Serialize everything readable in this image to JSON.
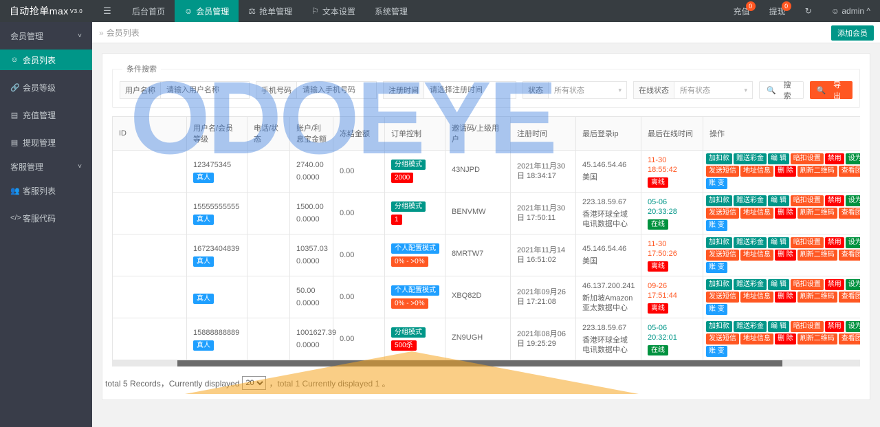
{
  "topbar": {
    "brand": "自动抢单max",
    "brand_version": "V3.0",
    "hamburger_icon": "menu-icon",
    "nav": [
      {
        "label": "后台首页",
        "icon": "",
        "active": false
      },
      {
        "label": "会员管理",
        "icon": "user-icon",
        "active": true
      },
      {
        "label": "抢单管理",
        "icon": "scale-icon",
        "active": false
      },
      {
        "label": "文本设置",
        "icon": "flag-icon",
        "active": false
      },
      {
        "label": "系统管理",
        "icon": "",
        "active": false
      }
    ],
    "recharge_label": "充值",
    "recharge_badge": "0",
    "withdraw_label": "提现",
    "withdraw_badge": "0",
    "refresh_icon": "refresh-icon",
    "user_label": "admin",
    "user_icon": "user-icon",
    "user_chevron": "chevron-up-icon"
  },
  "sidebar": {
    "groups": [
      {
        "label": "会员管理",
        "items": [
          {
            "label": "会员列表",
            "icon": "user-icon",
            "active": true
          },
          {
            "label": "会员等级",
            "icon": "link-icon",
            "active": false
          },
          {
            "label": "充值管理",
            "icon": "monitor-icon",
            "active": false
          },
          {
            "label": "提现管理",
            "icon": "monitor-icon",
            "active": false
          }
        ]
      },
      {
        "label": "客服管理",
        "items": [
          {
            "label": "客服列表",
            "icon": "users-icon",
            "active": false
          },
          {
            "label": "客服代码",
            "icon": "code-icon",
            "active": false
          }
        ]
      }
    ]
  },
  "breadcrumb": {
    "arrow": "»",
    "current": "会员列表",
    "add_button": "添加会员"
  },
  "search": {
    "legend": "条件搜索",
    "username": {
      "label": "用户名称",
      "placeholder": "请输入用户名称",
      "value": ""
    },
    "phone": {
      "label": "手机号码",
      "placeholder": "请输入手机号码",
      "value": ""
    },
    "regtime": {
      "label": "注册时间",
      "placeholder": "请选择注册时间",
      "value": ""
    },
    "status": {
      "label": "状态",
      "value": "所有状态"
    },
    "online": {
      "label": "在线状态",
      "value": "所有状态"
    },
    "search_button": "搜 索",
    "export_button": "导 出",
    "search_icon": "search-icon",
    "export_icon": "search-icon"
  },
  "table": {
    "columns": [
      "ID",
      "用户名/会员等级",
      "电话/状态",
      "账户/利息宝金额",
      "冻结金额",
      "订单控制",
      "邀请码/上级用户",
      "注册时间",
      "最后登录ip",
      "最后在线时间",
      "操作"
    ],
    "rows": [
      {
        "id": "",
        "username": "123475345",
        "level_tag": "真人",
        "phone": "",
        "status_tag": "",
        "account": "2740.00",
        "interest": "0.0000",
        "frozen": "0.00",
        "order_mode": "分组模式",
        "order_mode_color": "teal",
        "order_value": "2000",
        "order_value_color": "red",
        "invite_code": "43NJPD",
        "parent_user": "",
        "reg_time": "2021年11月30日 18:34:17",
        "last_ip": "45.146.54.46",
        "ip_location": "美国",
        "last_online_time": "11-30 18:55:42",
        "online_time_color": "red",
        "online_tag": "离线",
        "online_tag_color": "red"
      },
      {
        "id": "",
        "username": "15555555555",
        "level_tag": "真人",
        "phone": "",
        "status_tag": "",
        "account": "1500.00",
        "interest": "0.0000",
        "frozen": "0.00",
        "order_mode": "分组模式",
        "order_mode_color": "teal",
        "order_value": "1",
        "order_value_color": "red",
        "invite_code": "BENVMW",
        "parent_user": "",
        "reg_time": "2021年11月30日 17:50:11",
        "last_ip": "223.18.59.67",
        "ip_location": "香港环球全域电讯数据中心",
        "last_online_time": "05-06 20:33:28",
        "online_time_color": "green",
        "online_tag": "在线",
        "online_tag_color": "green"
      },
      {
        "id": "",
        "username": "16723404839",
        "level_tag": "真人",
        "phone": "",
        "status_tag": "",
        "account": "10357.03",
        "interest": "0.0000",
        "frozen": "0.00",
        "order_mode": "个人配置模式",
        "order_mode_color": "blue",
        "order_value": "0% - >0%",
        "order_value_color": "orange",
        "invite_code": "8MRTW7",
        "parent_user": "",
        "reg_time": "2021年11月14日 16:51:02",
        "last_ip": "45.146.54.46",
        "ip_location": "美国",
        "last_online_time": "11-30 17:50:26",
        "online_time_color": "red",
        "online_tag": "离线",
        "online_tag_color": "red"
      },
      {
        "id": "",
        "username": "",
        "level_tag": "真人",
        "phone": "",
        "status_tag": "",
        "account": "50.00",
        "interest": "0.0000",
        "frozen": "0.00",
        "order_mode": "个人配置模式",
        "order_mode_color": "blue",
        "order_value": "0% - >0%",
        "order_value_color": "orange",
        "invite_code": "XBQ82D",
        "parent_user": "",
        "reg_time": "2021年09月26日 17:21:08",
        "last_ip": "46.137.200.241",
        "ip_location": "新加坡Amazon亚太数据中心",
        "last_online_time": "09-26 17:51:44",
        "online_time_color": "red",
        "online_tag": "离线",
        "online_tag_color": "red"
      },
      {
        "id": "",
        "username": "15888888889",
        "level_tag": "真人",
        "phone": "",
        "status_tag": "",
        "account": "1001627.39",
        "interest": "0.0000",
        "frozen": "0.00",
        "order_mode": "分组模式",
        "order_mode_color": "teal",
        "order_value": "500杀",
        "order_value_color": "red",
        "invite_code": "ZN9UGH",
        "parent_user": "",
        "reg_time": "2021年08月06日 19:25:29",
        "last_ip": "223.18.59.67",
        "ip_location": "香港环球全域电讯数据中心",
        "last_online_time": "05-06 20:32:01",
        "online_time_color": "green",
        "online_tag": "在线",
        "online_tag_color": "green"
      }
    ],
    "actions": [
      {
        "label": "加扣款",
        "color": "teal"
      },
      {
        "label": "赠送彩金",
        "color": "teal"
      },
      {
        "label": "编 辑",
        "color": "teal"
      },
      {
        "label": "暗扣设置",
        "color": "orange"
      },
      {
        "label": "禁用",
        "color": "red"
      },
      {
        "label": "设为假人",
        "color": "dgreen"
      },
      {
        "label": "发送短信",
        "color": "orange"
      },
      {
        "label": "地址信息",
        "color": "orange"
      },
      {
        "label": "删 除",
        "color": "red"
      },
      {
        "label": "刷新二维码",
        "color": "orange"
      },
      {
        "label": "查看团队",
        "color": "orange"
      },
      {
        "label": "账 变",
        "color": "blue"
      }
    ]
  },
  "footer": {
    "prefix": "total 5 Records，Currently displayed",
    "page_size": "20",
    "page_size_options": [
      "20"
    ],
    "suffix": "，total 1 Currently displayed 1 。"
  },
  "watermark": {
    "text": "ODOEYE"
  }
}
